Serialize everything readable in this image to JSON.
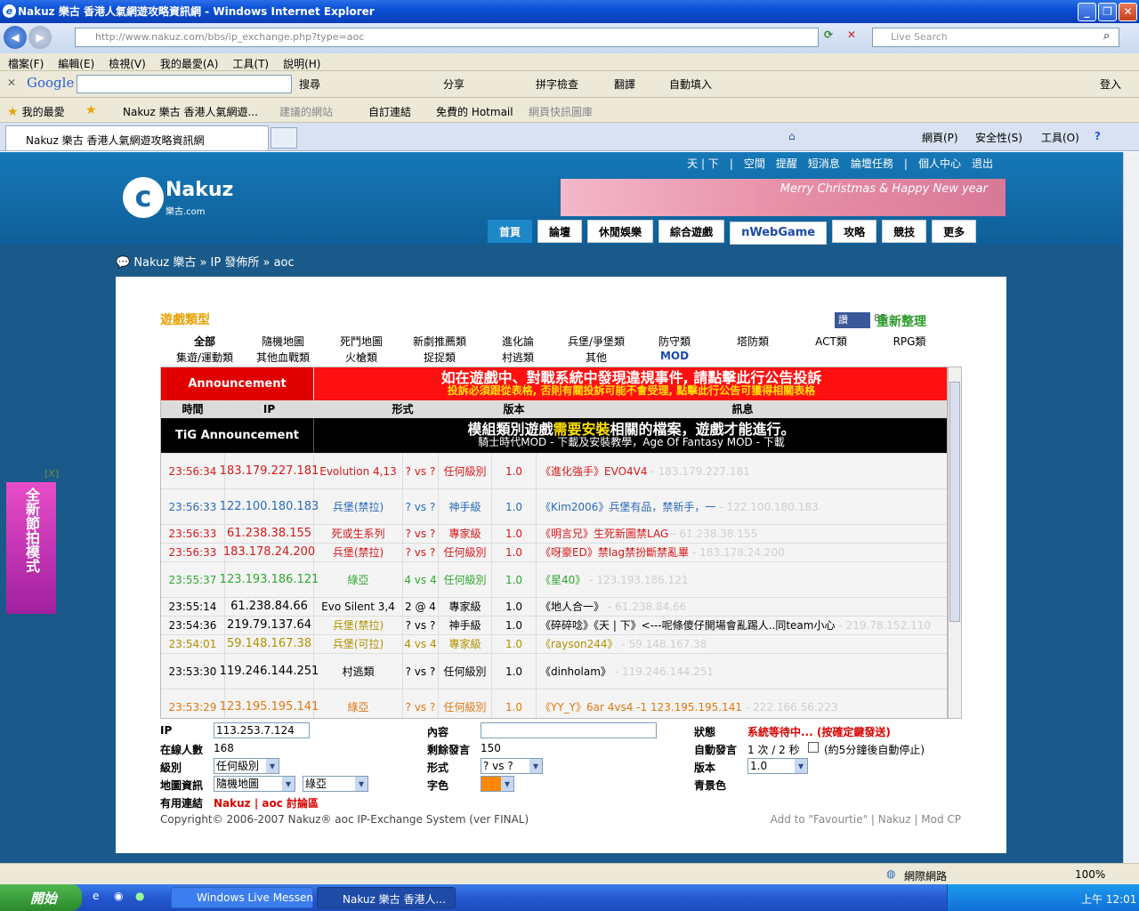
{
  "window": {
    "title": "Nakuz 樂古 香港人氣網遊攻略資訊網 - Windows Internet Explorer"
  },
  "address": {
    "url": "http://www.nakuz.com/bbs/ip_exchange.php?type=aoc",
    "search_placeholder": "Live Search"
  },
  "menu": [
    "檔案(F)",
    "編輯(E)",
    "檢視(V)",
    "我的最愛(A)",
    "工具(T)",
    "說明(H)"
  ],
  "google_toolbar": {
    "logo": "Google",
    "items": [
      "搜尋",
      "分享",
      "拼字檢查",
      "翻譯",
      "自動填入",
      "登入"
    ]
  },
  "favorites": {
    "label": "我的最愛",
    "items": [
      "Nakuz 樂古 香港人氣網遊...",
      "建議的網站",
      "自訂連結",
      "免費的 Hotmail",
      "網頁快訊圖庫"
    ]
  },
  "tab": {
    "label": "Nakuz 樂古 香港人氣網遊攻略資訊網",
    "tools": [
      "網頁(P)",
      "安全性(S)",
      "工具(O)"
    ]
  },
  "site": {
    "top_links": [
      "天 | 下",
      "|",
      "空間",
      "提醒",
      "短消息",
      "論壇任務",
      "|",
      "個人中心",
      "退出"
    ],
    "logo_name": "Nakuz",
    "logo_sub": "樂古.com",
    "banner_text": "Merry Christmas & Happy New year",
    "nav": [
      "首頁",
      "論壇",
      "休閒娛樂",
      "綜合遊戲",
      "nWebGame",
      "攻略",
      "競技",
      "更多"
    ],
    "breadcrumb": "Nakuz 樂古 » IP 發佈所 » aoc"
  },
  "game_types": {
    "title": "遊戲類型",
    "fb_label": "讚",
    "fb_count": "85",
    "refresh": "重新整理",
    "row1": [
      "全部",
      "隨機地圖",
      "死鬥地圖",
      "新劇推薦類",
      "進化論",
      "兵堡/爭堡類",
      "防守類",
      "塔防類",
      "ACT類",
      "RPG類"
    ],
    "row2": [
      "集遊/運動類",
      "其他血戰類",
      "火槍類",
      "捉捉類",
      "村逃類",
      "其他",
      "MOD"
    ]
  },
  "table": {
    "announcement_label": "Announcement",
    "announcement_line1": "如在遊戲中、對戰系統中發現違規事件, 請點擊此行公告投訴",
    "announcement_line2": "投訴必須跟從表格, 否則有關投訴可能不會受理, 點擊此行公告可獲得相關表格",
    "headers": [
      "時間",
      "IP",
      "形式",
      "版本",
      "訊息"
    ],
    "tig_label": "TiG Announcement",
    "tig_line1_a": "模組類別遊戲",
    "tig_line1_b": "需要安裝",
    "tig_line1_c": "相關的檔案，遊戲才能進行。",
    "tig_line2": "騎士時代MOD - 下載及安裝教學，Age Of Fantasy MOD - 下載",
    "rows": [
      {
        "time": "23:56:34",
        "ip": "183.179.227.181",
        "map": "Evolution 4,13",
        "mode": "? vs ?",
        "level": "任何級別",
        "ver": "1.0",
        "msg": "《進化強手》EVO4V4",
        "ghost": "- 183.179.227.181",
        "color": "#d81818"
      },
      {
        "time": "23:56:33",
        "ip": "122.100.180.183",
        "map": "兵堡(禁拉)",
        "mode": "? vs ?",
        "level": "神手級",
        "ver": "1.0",
        "msg": "《Kim2006》兵堡有品，禁新手，一",
        "ghost": "- 122.100.180.183",
        "color": "#2a6ab8"
      },
      {
        "time": "23:56:33",
        "ip": "61.238.38.155",
        "map": "死或生系列",
        "mode": "? vs ?",
        "level": "專家級",
        "ver": "1.0",
        "msg": "《明言兄》生死新圖禁LAG",
        "ghost": "- 61.238.38.155",
        "color": "#d81818"
      },
      {
        "time": "23:56:33",
        "ip": "183.178.24.200",
        "map": "兵堡(禁拉)",
        "mode": "? vs ?",
        "level": "任何級別",
        "ver": "1.0",
        "msg": "《呀豪ED》禁lag禁扮斷禁亂畢",
        "ghost": "- 183.178.24.200",
        "color": "#d81818"
      },
      {
        "time": "23:55:37",
        "ip": "123.193.186.121",
        "map": "綠亞",
        "mode": "4 vs 4",
        "level": "任何級別",
        "ver": "1.0",
        "msg": "《星40》",
        "ghost": "- 123.193.186.121",
        "color": "#2ea82e"
      },
      {
        "time": "23:55:14",
        "ip": "61.238.84.66",
        "map": "Evo Silent 3,4",
        "mode": "2 @ 4",
        "level": "專家級",
        "ver": "1.0",
        "msg": "《地人合一》",
        "ghost": "- 61.238.84.66",
        "color": "#000000"
      },
      {
        "time": "23:54:36",
        "ip": "219.79.137.64",
        "map": "兵堡(禁拉)",
        "mode": "? vs ?",
        "level": "神手級",
        "ver": "1.0",
        "msg": "《碎碎唸》《天 | 下》<---呢條傻仔開場會亂踢人..同team小心",
        "ghost": "- 219.78.152.110",
        "color": "#000000"
      },
      {
        "time": "23:54:01",
        "ip": "59.148.167.38",
        "map": "兵堡(可拉)",
        "mode": "4 vs 4",
        "level": "專家級",
        "ver": "1.0",
        "msg": "《rayson244》",
        "ghost": "- 59.148.167.38",
        "color": "#b09000"
      },
      {
        "time": "23:53:30",
        "ip": "119.246.144.251",
        "map": "村逃類",
        "mode": "? vs ?",
        "level": "任何級別",
        "ver": "1.0",
        "msg": "《dinholam》",
        "ghost": "- 119.246.144.251",
        "color": "#000000"
      },
      {
        "time": "23:53:29",
        "ip": "123.195.195.141",
        "map": "綠亞",
        "mode": "? vs ?",
        "level": "任何級別",
        "ver": "1.0",
        "msg": "《YY_Y》6ar 4vs4 -1   123.195.195.141",
        "ghost": "- 222.166.56.223",
        "color": "#e07810"
      }
    ]
  },
  "form": {
    "ip_label": "IP",
    "ip_value": "113.253.7.124",
    "content_label": "內容",
    "content_value": "",
    "status_label": "狀態",
    "status_value": "系統等待中... (按確定鍵發送)",
    "online_label": "在線人數",
    "online_value": "168",
    "remaining_label": "剩餘發言",
    "remaining_value": "150",
    "auto_label": "自動發言",
    "auto_value": "1 次 / 2 秒",
    "auto_note": "(約5分鐘後自動停止)",
    "level_label": "級別",
    "level_value": "任何級別",
    "mode_label": "形式",
    "mode_value": "? vs ?",
    "version_label": "版本",
    "version_value": "1.0",
    "map_label": "地圖資訊",
    "map_value1": "隨機地圖",
    "map_value2": "綠亞",
    "font_label": "字色",
    "bg_label": "青景色",
    "links_label": "有用連結",
    "links": "Nakuz | aoc 討論區"
  },
  "footer": {
    "copyright": "Copyright© 2006-2007  Nakuz® aoc IP-Exchange System (ver FINAL)",
    "links": "Add to \"Favourtie\" |  Nakuz | Mod CP"
  },
  "ad": {
    "close": "[X]",
    "text": "全新節拍模式"
  },
  "statusbar": {
    "zone": "網際網路",
    "zoom": "100%"
  },
  "taskbar": {
    "start": "開始",
    "items": [
      "Windows Live Messen...",
      "Nakuz 樂古 香港人..."
    ],
    "clock": "上午 12:01"
  }
}
